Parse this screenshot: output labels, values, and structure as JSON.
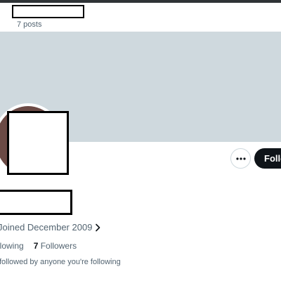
{
  "header": {
    "post_count": "7 posts"
  },
  "profile": {
    "joined_text": "Joined December 2009",
    "following_label": "llowing",
    "followers_count": "7",
    "followers_label": "Followers",
    "followed_by_text": "followed by anyone you're following"
  },
  "actions": {
    "more_glyph": "•••",
    "follow_label": "Follow"
  },
  "icons": {
    "more": "more-horizontal-icon",
    "chevron": "chevron-right-icon"
  },
  "colors": {
    "banner": "#cfd9de",
    "follow_button": "#0f1419",
    "secondary_text": "#536471"
  }
}
